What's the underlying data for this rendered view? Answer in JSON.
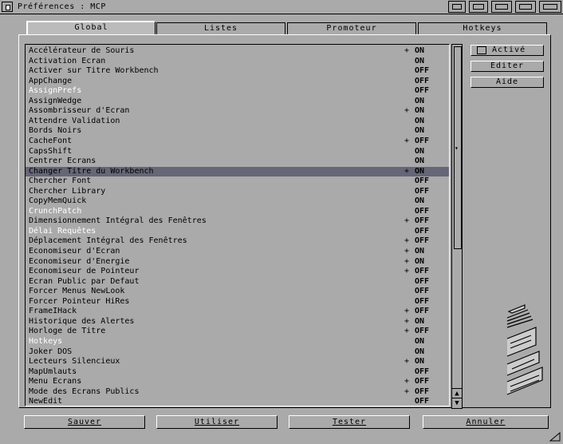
{
  "window": {
    "title": "Préférences : MCP"
  },
  "tabs": [
    "Global",
    "Listes",
    "Promoteur",
    "Hotkeys"
  ],
  "side": {
    "active_label": "Activé",
    "edit_label": "Editer",
    "help_label": "Aide"
  },
  "list": [
    {
      "name": "Accélérateur de Souris",
      "plus": "+",
      "state": "ON"
    },
    {
      "name": "Activation Ecran",
      "plus": "",
      "state": "ON"
    },
    {
      "name": "Activer sur Titre Workbench",
      "plus": "",
      "state": "OFF"
    },
    {
      "name": "AppChange",
      "plus": "",
      "state": "OFF"
    },
    {
      "name": "AssignPrefs",
      "plus": "",
      "state": "OFF",
      "white": true
    },
    {
      "name": "AssignWedge",
      "plus": "",
      "state": "ON"
    },
    {
      "name": "Assombrisseur d'Ecran",
      "plus": "+",
      "state": "ON"
    },
    {
      "name": "Attendre Validation",
      "plus": "",
      "state": "ON"
    },
    {
      "name": "Bords Noirs",
      "plus": "",
      "state": "ON"
    },
    {
      "name": "CacheFont",
      "plus": "+",
      "state": "OFF"
    },
    {
      "name": "CapsShift",
      "plus": "",
      "state": "ON"
    },
    {
      "name": "Centrer Ecrans",
      "plus": "",
      "state": "ON"
    },
    {
      "name": "Changer Titre du Workbench",
      "plus": "+",
      "state": "ON",
      "hl": true
    },
    {
      "name": "Chercher Font",
      "plus": "",
      "state": "OFF"
    },
    {
      "name": "Chercher Library",
      "plus": "",
      "state": "OFF"
    },
    {
      "name": "CopyMemQuick",
      "plus": "",
      "state": "ON"
    },
    {
      "name": "CrunchPatch",
      "plus": "",
      "state": "OFF",
      "white": true
    },
    {
      "name": "Dimensionnement Intégral des Fenêtres",
      "plus": "+",
      "state": "OFF"
    },
    {
      "name": "Délai Requêtes",
      "plus": "",
      "state": "OFF",
      "white": true
    },
    {
      "name": "Déplacement Intégral des Fenêtres",
      "plus": "+",
      "state": "OFF"
    },
    {
      "name": "Economiseur d'Ecran",
      "plus": "+",
      "state": "ON"
    },
    {
      "name": "Economiseur d'Energie",
      "plus": "+",
      "state": "ON"
    },
    {
      "name": "Economiseur de Pointeur",
      "plus": "+",
      "state": "OFF"
    },
    {
      "name": "Ecran Public par Defaut",
      "plus": "",
      "state": "OFF"
    },
    {
      "name": "Forcer Menus NewLook",
      "plus": "",
      "state": "OFF"
    },
    {
      "name": "Forcer Pointeur HiRes",
      "plus": "",
      "state": "OFF"
    },
    {
      "name": "FrameIHack",
      "plus": "+",
      "state": "OFF"
    },
    {
      "name": "Historique des Alertes",
      "plus": "+",
      "state": "ON"
    },
    {
      "name": "Horloge de Titre",
      "plus": "+",
      "state": "OFF"
    },
    {
      "name": "Hotkeys",
      "plus": "",
      "state": "ON",
      "white": true
    },
    {
      "name": "Joker DOS",
      "plus": "",
      "state": "ON"
    },
    {
      "name": "Lecteurs Silencieux",
      "plus": "+",
      "state": "ON"
    },
    {
      "name": "MapUmlauts",
      "plus": "",
      "state": "OFF"
    },
    {
      "name": "Menu Ecrans",
      "plus": "+",
      "state": "OFF"
    },
    {
      "name": "Mode des Ecrans Publics",
      "plus": "+",
      "state": "OFF"
    },
    {
      "name": "NewEdit",
      "plus": "",
      "state": "OFF"
    }
  ],
  "bottom": {
    "save": "Sauver",
    "use": "Utiliser",
    "test": "Tester",
    "cancel": "Annuler"
  },
  "colors": {
    "background": "#aaaaaa",
    "highlight": "#666677",
    "text": "#000000",
    "light_text": "#ffffff"
  }
}
